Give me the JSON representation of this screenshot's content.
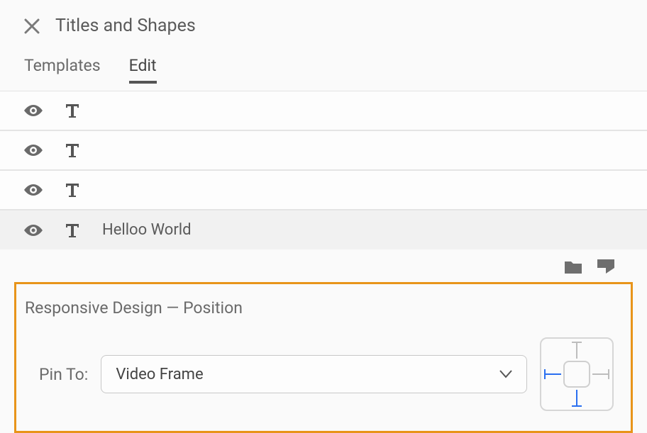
{
  "panel": {
    "title": "Titles and Shapes"
  },
  "tabs": [
    {
      "label": "Templates",
      "active": false
    },
    {
      "label": "Edit",
      "active": true
    }
  ],
  "layers": [
    {
      "label": "",
      "selected": false
    },
    {
      "label": "",
      "selected": false
    },
    {
      "label": "",
      "selected": false
    },
    {
      "label": "Helloo World",
      "selected": true
    }
  ],
  "responsive": {
    "section_title": "Responsive Design — Position",
    "pin_label": "Pin To:",
    "pin_select_value": "Video Frame",
    "pins": {
      "top": false,
      "right": false,
      "bottom": true,
      "left": true
    }
  },
  "colors": {
    "accent": "#2a6ff0",
    "highlight_border": "#e8941a"
  }
}
